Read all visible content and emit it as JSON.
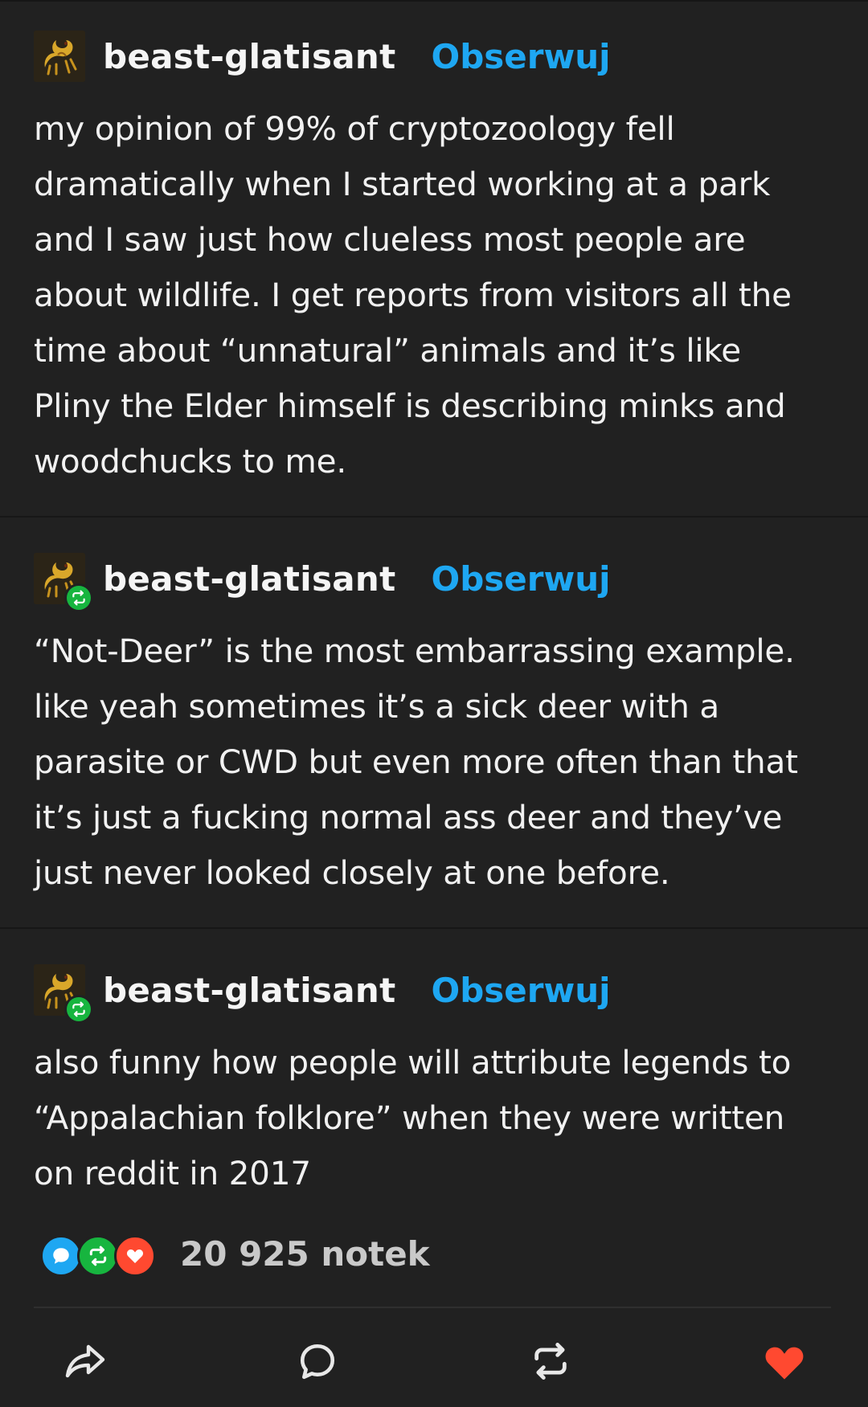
{
  "posts": [
    {
      "username": "beast-glatisant",
      "follow_label": "Obserwuj",
      "is_reblog": false,
      "lines": [
        "my opinion of 99% of cryptozoology fell",
        "dramatically when I started working at a park",
        "and I saw just how clueless most people are",
        "about wildlife. I get reports from visitors all the",
        "time about “unnatural” animals and it’s like",
        "Pliny the Elder himself is describing minks and",
        "woodchucks to me."
      ]
    },
    {
      "username": "beast-glatisant",
      "follow_label": "Obserwuj",
      "is_reblog": true,
      "lines": [
        "“Not-Deer” is the most embarrassing example.",
        "like yeah sometimes it’s a sick deer with a",
        "parasite or CWD but even more often than that",
        "it’s just a fucking normal ass deer and they’ve",
        "just never looked closely at one before."
      ]
    },
    {
      "username": "beast-glatisant",
      "follow_label": "Obserwuj",
      "is_reblog": true,
      "lines": [
        "also funny how people will attribute legends to",
        "“Appalachian folklore” when they were written",
        "on reddit in 2017"
      ]
    }
  ],
  "notes": {
    "count_label": "20 925 notek",
    "icons": [
      "reply-bubble-icon",
      "reblog-icon",
      "heart-icon"
    ],
    "colors": {
      "reply": "#1ea7f2",
      "reblog": "#17b53f",
      "like": "#ff4930"
    }
  },
  "actions": [
    {
      "name": "share-icon",
      "liked": false
    },
    {
      "name": "reply-icon",
      "liked": false
    },
    {
      "name": "reblog-icon",
      "liked": false
    },
    {
      "name": "like-icon",
      "liked": true
    }
  ],
  "colors": {
    "background": "#212121",
    "accent": "#1ea7f2",
    "text": "#f1f1f1",
    "like": "#ff4930"
  }
}
